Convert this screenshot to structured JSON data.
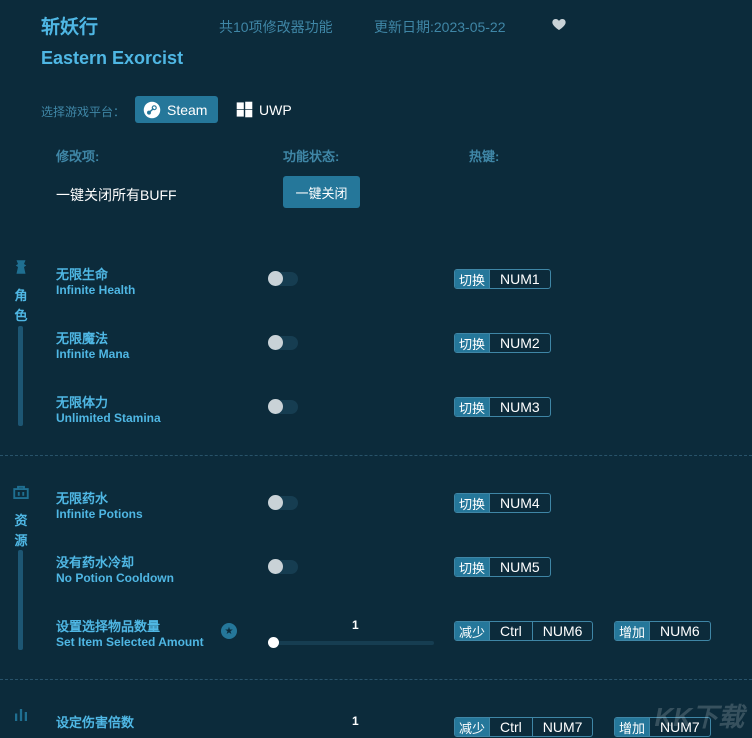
{
  "header": {
    "title_cn": "斩妖行",
    "feature_count": "共10项修改器功能",
    "update_date": "更新日期:2023-05-22",
    "title_en": "Eastern Exorcist"
  },
  "platform": {
    "label": "选择游戏平台：",
    "steam": "Steam",
    "uwp": "UWP"
  },
  "columns": {
    "mod": "修改项:",
    "status": "功能状态:",
    "hotkey": "热键:"
  },
  "global": {
    "label": "一键关闭所有BUFF",
    "button": "一键关闭"
  },
  "categories": [
    {
      "name_1": "角",
      "name_2": "色",
      "icon": "character-icon"
    },
    {
      "name_1": "资",
      "name_2": "源",
      "icon": "resource-icon"
    }
  ],
  "rows": [
    {
      "cn": "无限生命",
      "en": "Infinite Health",
      "type": "toggle",
      "action": "切换",
      "key": "NUM1"
    },
    {
      "cn": "无限魔法",
      "en": "Infinite Mana",
      "type": "toggle",
      "action": "切换",
      "key": "NUM2"
    },
    {
      "cn": "无限体力",
      "en": "Unlimited Stamina",
      "type": "toggle",
      "action": "切换",
      "key": "NUM3"
    },
    {
      "cn": "无限药水",
      "en": "Infinite Potions",
      "type": "toggle",
      "action": "切换",
      "key": "NUM4"
    },
    {
      "cn": "没有药水冷却",
      "en": "No Potion Cooldown",
      "type": "toggle",
      "action": "切换",
      "key": "NUM5"
    },
    {
      "cn": "设置选择物品数量",
      "en": "Set Item Selected Amount",
      "type": "slider",
      "value": "1",
      "dec_action": "减少",
      "dec_mod": "Ctrl",
      "dec_key": "NUM6",
      "inc_action": "增加",
      "inc_key": "NUM6"
    },
    {
      "cn": "设定伤害倍数",
      "en": "",
      "type": "slider",
      "value": "1",
      "dec_action": "减少",
      "dec_mod": "Ctrl",
      "dec_key": "NUM7",
      "inc_action": "增加",
      "inc_key": "NUM7"
    }
  ],
  "watermark": "KK下载",
  "colors": {
    "background": "#0c2b3b",
    "accent": "#4fb7e4",
    "button": "#25779a",
    "muted": "#3f86a6"
  }
}
